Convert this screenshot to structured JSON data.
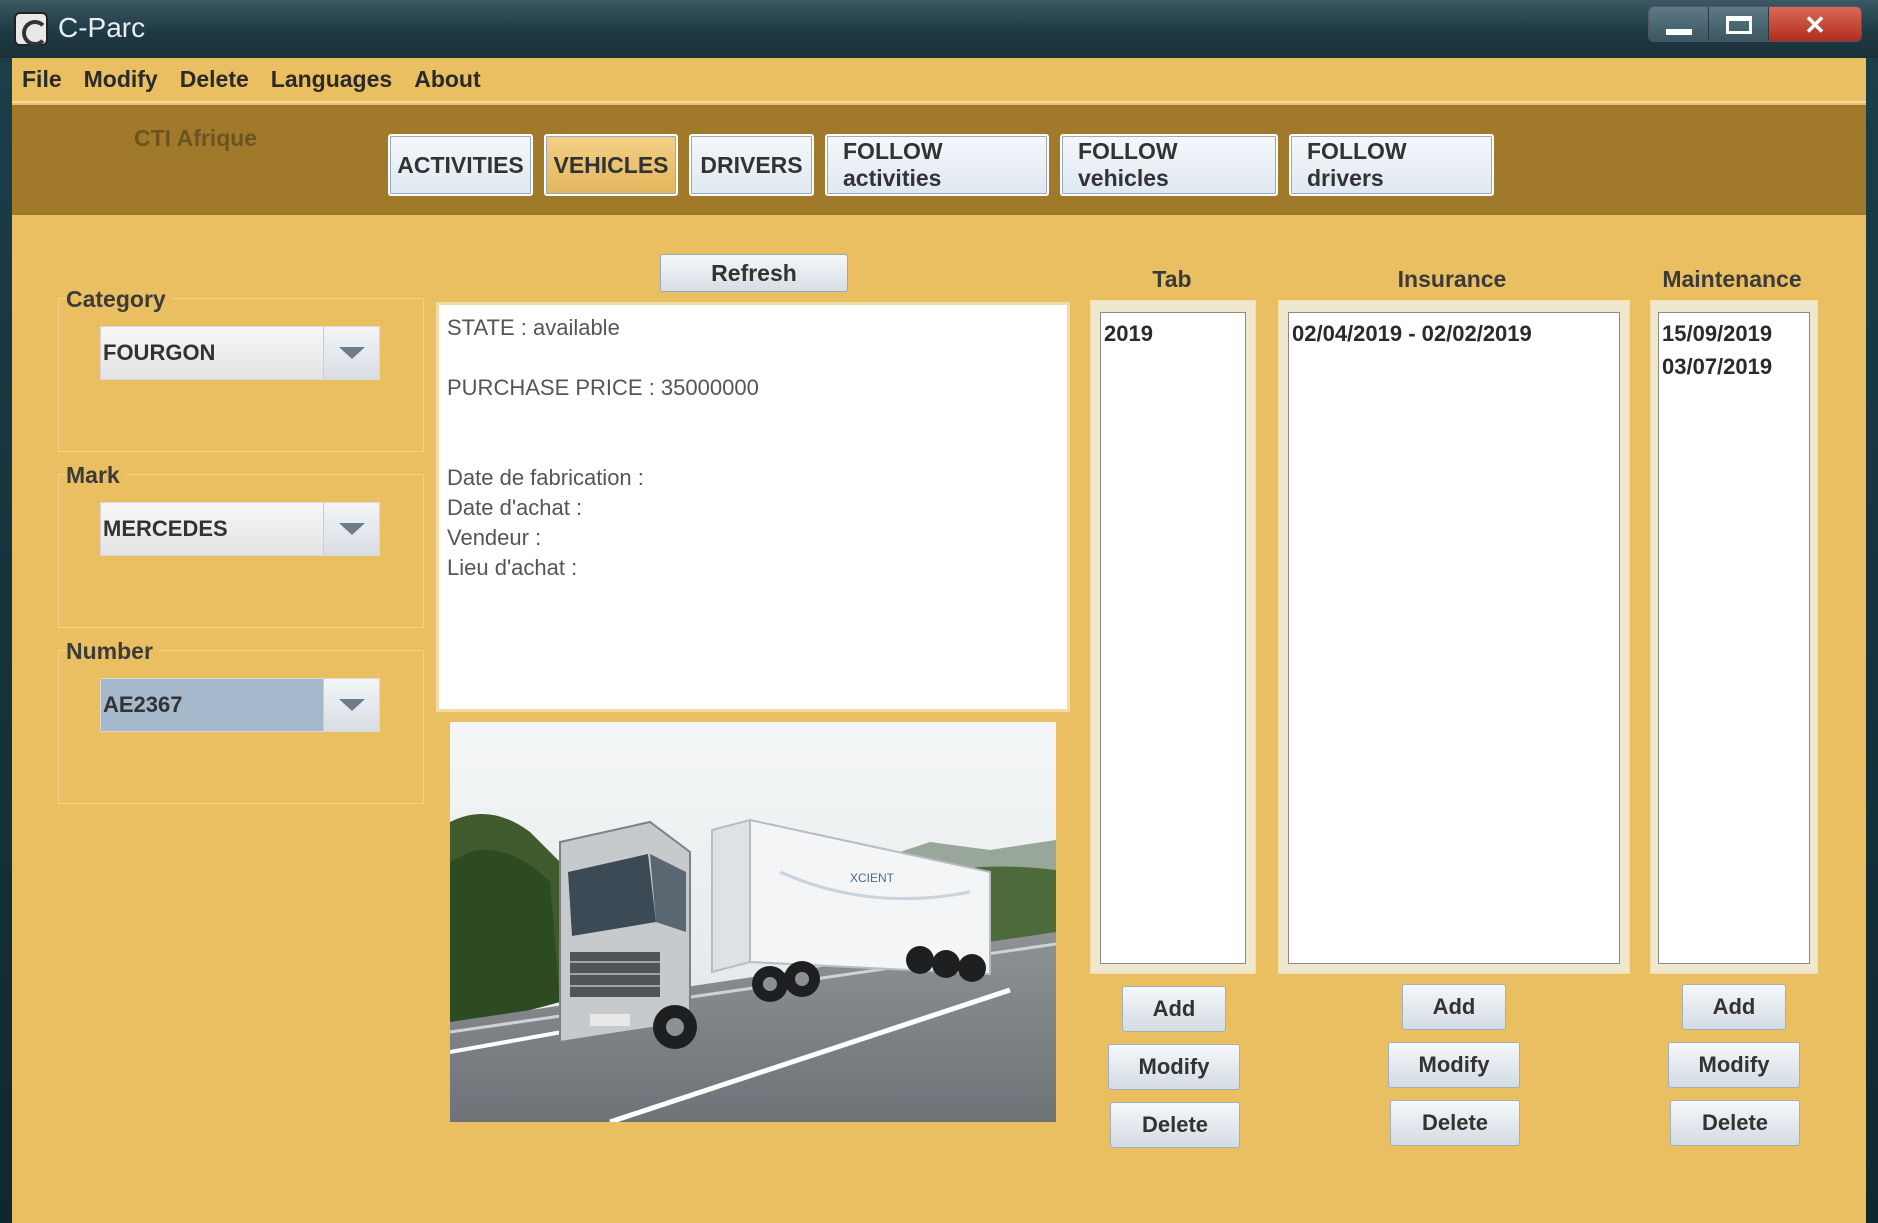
{
  "window": {
    "title": "C-Parc"
  },
  "menu": [
    "File",
    "Modify",
    "Delete",
    "Languages",
    "About"
  ],
  "company": "CTI Afrique",
  "tabs": [
    "ACTIVITIES",
    "VEHICLES",
    "DRIVERS",
    "FOLLOW activities",
    "FOLLOW vehicles",
    "FOLLOW drivers"
  ],
  "active_tab": "VEHICLES",
  "filters": {
    "category": {
      "label": "Category",
      "value": "FOURGON"
    },
    "mark": {
      "label": "Mark",
      "value": "MERCEDES"
    },
    "number": {
      "label": "Number",
      "value": "AE2367"
    }
  },
  "refresh_label": "Refresh",
  "info": {
    "state": "STATE : available",
    "price": "PURCHASE PRICE : 35000000",
    "fab": "Date de fabrication :",
    "achat": "Date d'achat :",
    "vendeur": "Vendeur :",
    "lieu": "Lieu d'achat :"
  },
  "columns": {
    "tab": {
      "title": "Tab",
      "items": [
        "2019"
      ]
    },
    "insurance": {
      "title": "Insurance",
      "items": [
        "02/04/2019 - 02/02/2019"
      ]
    },
    "maintenance": {
      "title": "Maintenance",
      "items": [
        "15/09/2019",
        "03/07/2019"
      ]
    }
  },
  "buttons": {
    "add": "Add",
    "modify": "Modify",
    "delete": "Delete"
  }
}
